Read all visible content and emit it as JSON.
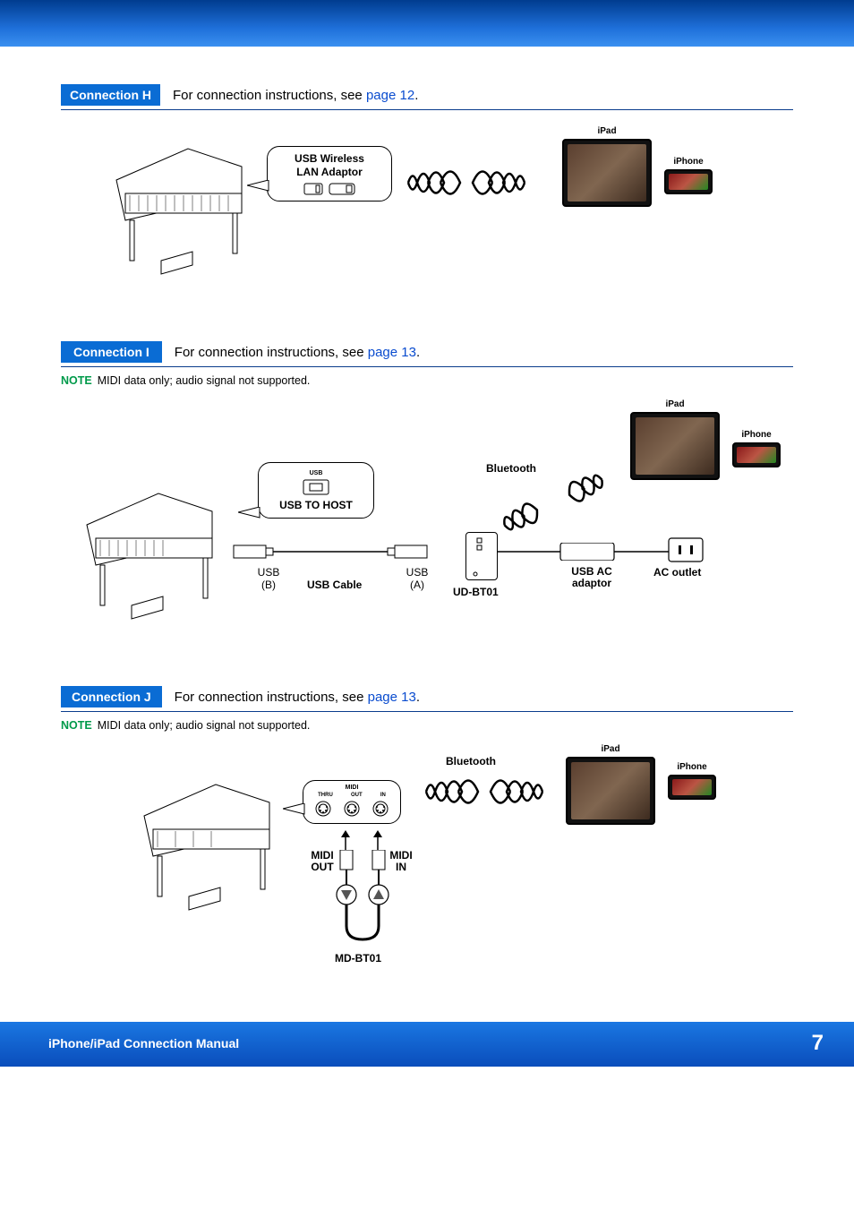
{
  "sections": {
    "h": {
      "tag": "Connection H",
      "instruction_prefix": "For connection instructions, see ",
      "page_link": "page 12",
      "period": ".",
      "labels": {
        "adaptor_line1": "USB Wireless",
        "adaptor_line2": "LAN Adaptor",
        "ipad": "iPad",
        "iphone": "iPhone"
      }
    },
    "i": {
      "tag": "Connection I",
      "instruction_prefix": "For connection instructions, see ",
      "page_link": "page 13",
      "period": ".",
      "note_label": "NOTE",
      "note_text": "MIDI data only; audio signal not supported.",
      "labels": {
        "usb_port_small": "USB",
        "usb_to_host": "USB TO HOST",
        "usb_b": "USB",
        "usb_b_sub": "(B)",
        "usb_cable": "USB Cable",
        "usb_a": "USB",
        "usb_a_sub": "(A)",
        "ud_bt01": "UD-BT01",
        "bluetooth": "Bluetooth",
        "usb_ac": "USB AC",
        "adaptor": "adaptor",
        "ac_outlet": "AC outlet",
        "ipad": "iPad",
        "iphone": "iPhone"
      }
    },
    "j": {
      "tag": "Connection J",
      "instruction_prefix": "For connection instructions, see ",
      "page_link": "page 13",
      "period": ".",
      "note_label": "NOTE",
      "note_text": "MIDI data only; audio signal not supported.",
      "labels": {
        "midi": "MIDI",
        "thru": "THRU",
        "out": "OUT",
        "in": "IN",
        "midi_out": "MIDI",
        "midi_out2": "OUT",
        "midi_in": "MIDI",
        "midi_in2": "IN",
        "md_bt01": "MD-BT01",
        "bluetooth": "Bluetooth",
        "ipad": "iPad",
        "iphone": "iPhone"
      }
    }
  },
  "footer": {
    "title": "iPhone/iPad Connection Manual",
    "page": "7"
  }
}
